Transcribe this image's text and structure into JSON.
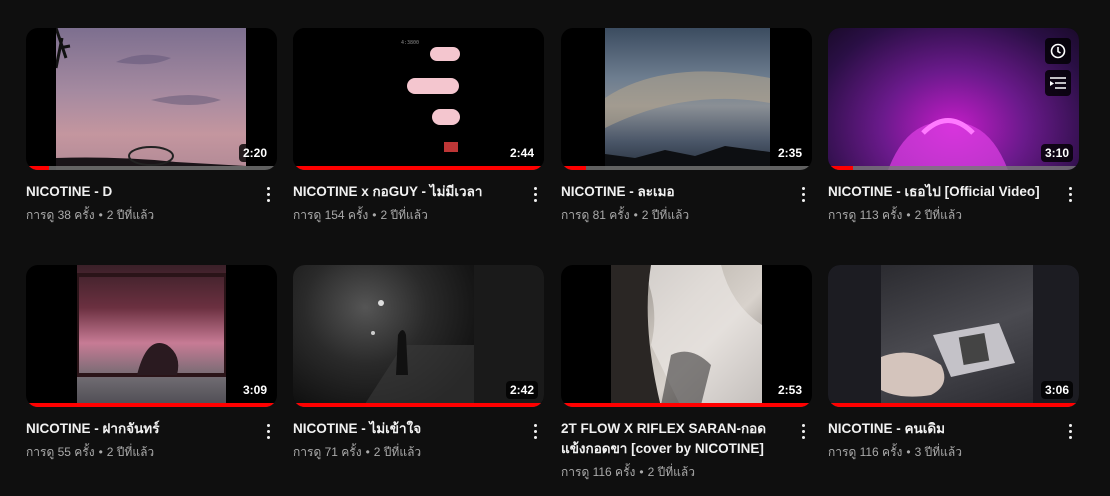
{
  "videos": [
    {
      "title": "NICOTINE - D",
      "views": "การดู 38 ครั้ง",
      "age": "2 ปีที่แล้ว",
      "duration": "2:20",
      "watched": 0.09
    },
    {
      "title": "NICOTINE x กอGUY - ไม่มีเวลา",
      "views": "การดู 154 ครั้ง",
      "age": "2 ปีที่แล้ว",
      "duration": "2:44",
      "watched": 1.0
    },
    {
      "title": "NICOTINE - ละเมอ",
      "views": "การดู 81 ครั้ง",
      "age": "2 ปีที่แล้ว",
      "duration": "2:35",
      "watched": 0.1
    },
    {
      "title": "NICOTINE - เธอไป [Official Video]",
      "views": "การดู 113 ครั้ง",
      "age": "2 ปีที่แล้ว",
      "duration": "3:10",
      "watched": 0.1
    },
    {
      "title": "NICOTINE - ฝากจันทร์",
      "views": "การดู 55 ครั้ง",
      "age": "2 ปีที่แล้ว",
      "duration": "3:09",
      "watched": 1.0
    },
    {
      "title": "NICOTINE - ไม่เข้าใจ",
      "views": "การดู 71 ครั้ง",
      "age": "2 ปีที่แล้ว",
      "duration": "2:42",
      "watched": 1.0
    },
    {
      "title": "2T FLOW X RIFLEX SARAN-กอดแข้งกอดขา [cover by NICOTINE]",
      "views": "การดู 116 ครั้ง",
      "age": "2 ปีที่แล้ว",
      "duration": "2:53",
      "watched": 1.0
    },
    {
      "title": "NICOTINE - คนเดิม",
      "views": "การดู 116 ครั้ง",
      "age": "3 ปีที่แล้ว",
      "duration": "3:06",
      "watched": 1.0
    }
  ],
  "hover_actions": {
    "watch_later_icon": "clock-icon",
    "add_to_queue_icon": "queue-icon"
  },
  "colors": {
    "background": "#0f0f0f",
    "progress": "#ff0000",
    "meta": "#aaaaaa"
  }
}
